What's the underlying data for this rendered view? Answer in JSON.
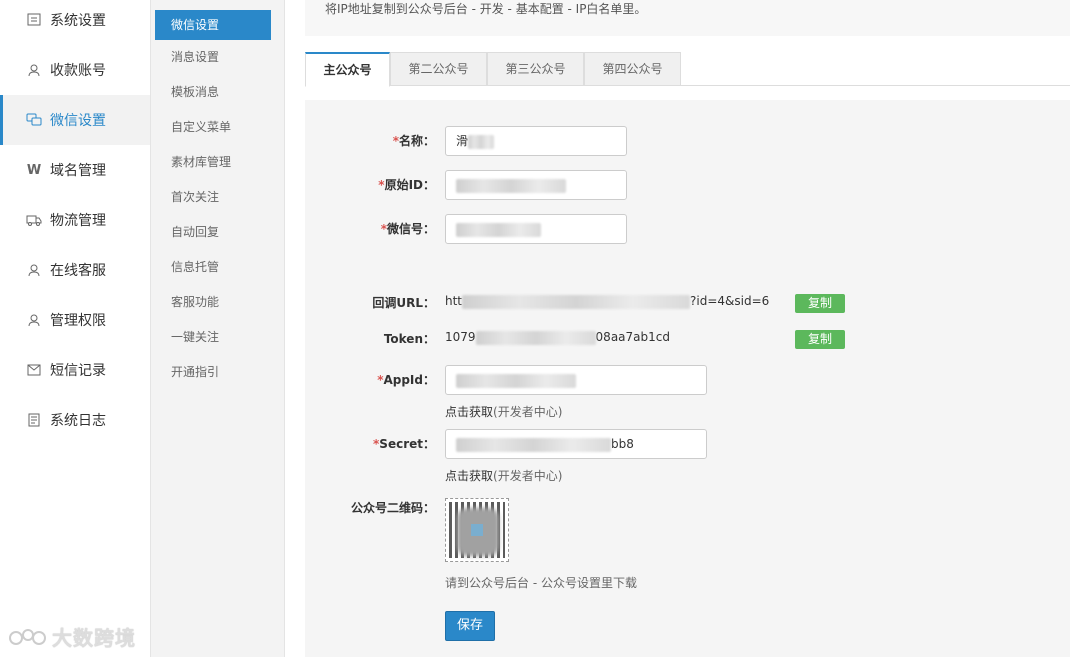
{
  "nav1": [
    {
      "label": "系统设置",
      "icon": "settings-icon"
    },
    {
      "label": "收款账号",
      "icon": "user-icon"
    },
    {
      "label": "微信设置",
      "icon": "wechat-icon",
      "active": true
    },
    {
      "label": "域名管理",
      "icon": "w-domain-icon"
    },
    {
      "label": "物流管理",
      "icon": "truck-icon"
    },
    {
      "label": "在线客服",
      "icon": "support-icon"
    },
    {
      "label": "管理权限",
      "icon": "admin-icon"
    },
    {
      "label": "短信记录",
      "icon": "mail-icon"
    },
    {
      "label": "系统日志",
      "icon": "log-icon"
    }
  ],
  "nav2": [
    "微信设置",
    "消息设置",
    "模板消息",
    "自定义菜单",
    "素材库管理",
    "首次关注",
    "自动回复",
    "信息托管",
    "客服功能",
    "一键关注",
    "开通指引"
  ],
  "tip": "将IP地址复制到公众号后台 - 开发 - 基本配置 - IP白名单里。",
  "tabs": [
    "主公众号",
    "第二公众号",
    "第三公众号",
    "第四公众号"
  ],
  "form": {
    "name_label": "名称：",
    "name_value": "滑",
    "origin_label": "原始ID：",
    "wechat_label": "微信号：",
    "callback_label": "回调URL：",
    "callback_prefix": "htt",
    "callback_suffix": "?id=4&sid=6",
    "token_label": "Token：",
    "token_prefix": "1079",
    "token_suffix": "08aa7ab1cd",
    "copy": "复制",
    "appid_label": "AppId：",
    "appid_hint_link": "点击获取",
    "appid_hint_rest": "(开发者中心)",
    "secret_label": "Secret：",
    "secret_suffix": "bb8",
    "secret_hint_link": "点击获取",
    "secret_hint_rest": "(开发者中心)",
    "qr_label": "公众号二维码：",
    "qr_hint": "请到公众号后台 - 公众号设置里下载",
    "save": "保存",
    "required_mark": "*"
  },
  "watermark": "大数跨境",
  "colors": {
    "accent": "#2a88c9",
    "copy_btn": "#5cb85c",
    "required": "#d9534f"
  }
}
